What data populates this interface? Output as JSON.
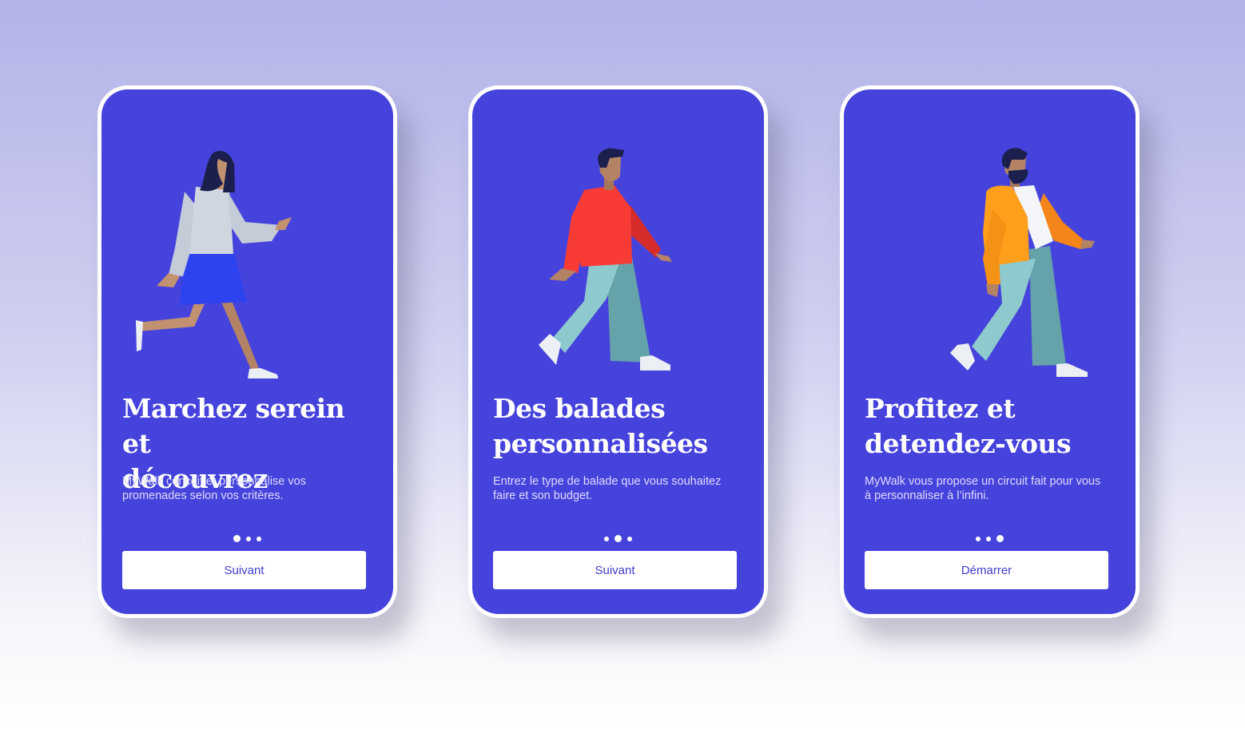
{
  "colors": {
    "screen": "#4643dd",
    "button_text": "#3f3cc9",
    "background_top": "#b3b3e9"
  },
  "screens": [
    {
      "illustration": "walking-woman-illustration",
      "title_line1": "Marchez serein et",
      "title_line2": "découvrez",
      "subtitle_line1": "MyWalk concoit et personnalise vos",
      "subtitle_line2": "promenades selon vos critères.",
      "active_dot": 1,
      "button_label": "Suivant"
    },
    {
      "illustration": "walking-man-red-sweater-illustration",
      "title_line1": "Des balades",
      "title_line2": "personnalisées",
      "subtitle_line1": "Entrez le type de balade que vous souhaitez",
      "subtitle_line2": "faire et son budget.",
      "active_dot": 2,
      "button_label": "Suivant"
    },
    {
      "illustration": "walking-bearded-man-illustration",
      "title_line1": "Profitez et",
      "title_line2": "detendez-vous",
      "subtitle_line1": "MyWalk vous propose un circuit fait pour vous",
      "subtitle_line2": "à personnaliser à l’infini.",
      "active_dot": 3,
      "button_label": "Démarrer"
    }
  ]
}
